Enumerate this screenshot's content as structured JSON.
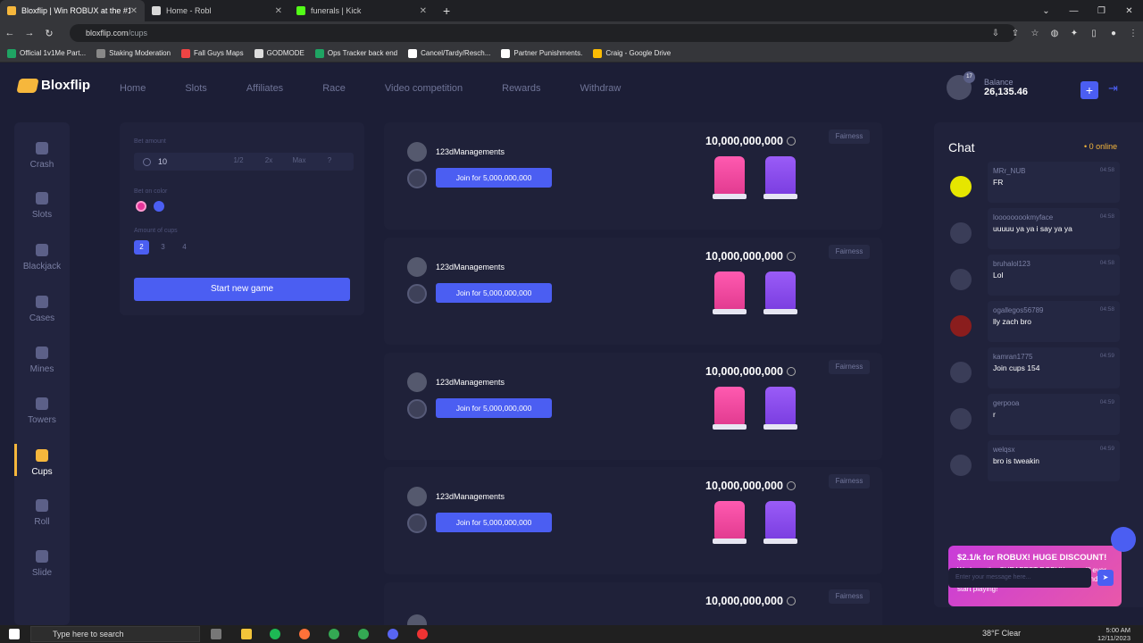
{
  "browser": {
    "tabs": [
      {
        "label": "Bloxflip | Win ROBUX at the #1 R",
        "active": true
      },
      {
        "label": "Home - Robl",
        "active": false
      },
      {
        "label": "funerals | Kick",
        "active": false
      }
    ],
    "url_domain": "bloxflip.com",
    "url_path": "/cups",
    "bookmarks": [
      "Official 1v1Me Part...",
      "Staking Moderation",
      "Fall Guys Maps",
      "GODMODE",
      "Ops Tracker back end",
      "Cancel/Tardy/Resch...",
      "Partner Punishments.",
      "Craig - Google Drive"
    ]
  },
  "site": {
    "logo": "Bloxflip",
    "menu": [
      "Home",
      "Slots",
      "Affiliates",
      "Race",
      "Video competition",
      "Rewards",
      "Withdraw"
    ],
    "balance_label": "Balance",
    "balance_value": "26,135.46",
    "level": "17"
  },
  "sidebar": [
    {
      "label": "Crash",
      "active": false
    },
    {
      "label": "Slots",
      "active": false
    },
    {
      "label": "Blackjack",
      "active": false
    },
    {
      "label": "Cases",
      "active": false
    },
    {
      "label": "Mines",
      "active": false
    },
    {
      "label": "Towers",
      "active": false
    },
    {
      "label": "Cups",
      "active": true
    },
    {
      "label": "Roll",
      "active": false
    },
    {
      "label": "Slide",
      "active": false
    }
  ],
  "bet_panel": {
    "bet_amount_label": "Bet amount",
    "bet_amount_value": "10",
    "modifiers": [
      "1/2",
      "2x",
      "Max",
      "?"
    ],
    "color_label": "Bet on color",
    "colors": [
      "#e6359a",
      "#4b5ef2"
    ],
    "cups_label": "Amount of cups",
    "cup_options": [
      "2",
      "3",
      "4"
    ],
    "selected_cups": "2",
    "start_label": "Start new game"
  },
  "games": [
    {
      "user": "123dManagements",
      "join_label": "Join for 5,000,000,000",
      "pot": "10,000,000,000",
      "fairness": "Fairness"
    },
    {
      "user": "123dManagements",
      "join_label": "Join for 5,000,000,000",
      "pot": "10,000,000,000",
      "fairness": "Fairness"
    },
    {
      "user": "123dManagements",
      "join_label": "Join for 5,000,000,000",
      "pot": "10,000,000,000",
      "fairness": "Fairness"
    },
    {
      "user": "123dManagements",
      "join_label": "Join for 5,000,000,000",
      "pot": "10,000,000,000",
      "fairness": "Fairness"
    },
    {
      "user": "",
      "join_label": "",
      "pot": "10,000,000,000",
      "fairness": "Fairness"
    }
  ],
  "chat": {
    "title": "Chat",
    "online": "0 online",
    "messages": [
      {
        "user": "MRr_NUB",
        "time": "04:58",
        "text": "FR"
      },
      {
        "user": "looooooookmyface",
        "time": "04:58",
        "text": "uuuuu ya ya i say ya ya"
      },
      {
        "user": "bruhalol123",
        "time": "04:58",
        "text": "Lol"
      },
      {
        "user": "ogallegos56789",
        "time": "04:58",
        "text": "lly zach bro"
      },
      {
        "user": "kamran1775",
        "time": "04:59",
        "text": "Join cups 154"
      },
      {
        "user": "gerpooa",
        "time": "04:59",
        "text": "r"
      },
      {
        "user": "welqsx",
        "time": "04:59",
        "text": "bro is tweakin"
      }
    ],
    "promo_title": "$2.1/k for ROBUX! HUGE DISCOUNT!",
    "promo_body": "We have the CHEAPEST ROBUX you will ever find! Buy right NOW with Card or Crypto and start playing!",
    "input_placeholder": "Enter your message here..."
  },
  "taskbar": {
    "search_placeholder": "Type here to search",
    "weather": "38°F  Clear",
    "time": "5:00 AM",
    "date": "12/11/2023"
  }
}
